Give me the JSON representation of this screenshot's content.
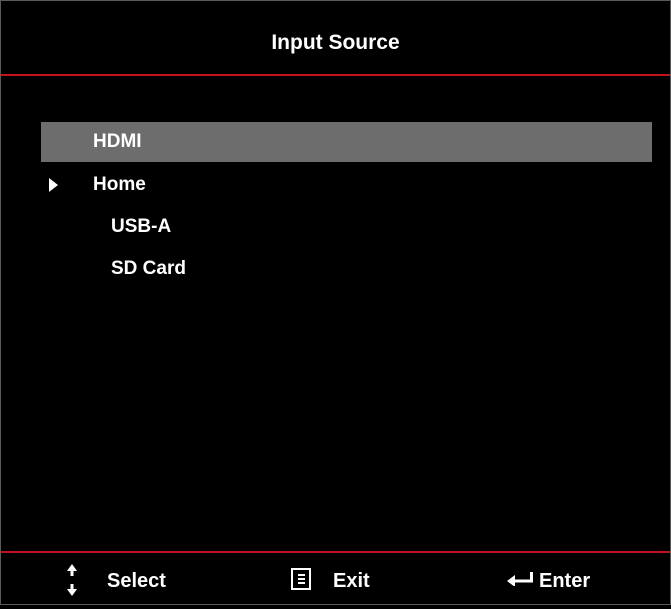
{
  "title": "Input Source",
  "menu": {
    "items": [
      {
        "label": "HDMI",
        "selected": true,
        "expanded": false,
        "indent": 0
      },
      {
        "label": "Home",
        "selected": false,
        "expanded": true,
        "indent": 0
      },
      {
        "label": "USB-A",
        "selected": false,
        "expanded": false,
        "indent": 1
      },
      {
        "label": "SD Card",
        "selected": false,
        "expanded": false,
        "indent": 1
      }
    ]
  },
  "footer": {
    "select_label": "Select",
    "select_icon": "up-down-arrows-icon",
    "exit_label": "Exit",
    "exit_icon": "menu-icon",
    "enter_label": "Enter",
    "enter_icon": "enter-arrow-icon"
  },
  "colors": {
    "background": "#000000",
    "separator": "#c4121f",
    "selection": "#6d6d6d",
    "text": "#ffffff"
  }
}
